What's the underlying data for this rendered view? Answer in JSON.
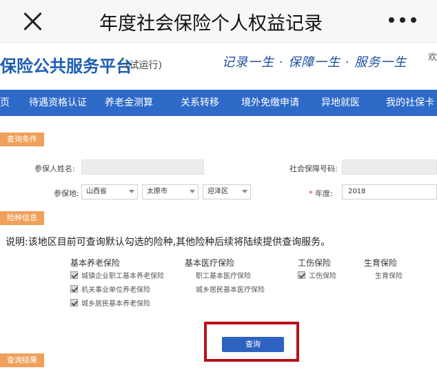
{
  "wechat_bar": {
    "title": "年度社会保险个人权益记录"
  },
  "site": {
    "title": "保险公共服务平台",
    "subtitle": "(试运行)",
    "slogan": "记录一生 · 保障一生 · 服务一生",
    "slogan_tail": "欢"
  },
  "nav": {
    "items": [
      "页",
      "待遇资格认证",
      "养老金测算",
      "关系转移",
      "境外免缴申请",
      "异地就医",
      "我的社保卡"
    ]
  },
  "query_conditions": {
    "tag": "查询条件",
    "name_label": "参保人姓名:",
    "ssn_label": "社会保障号码:",
    "location_label": "参保地:",
    "province": "山西省",
    "city": "太原市",
    "district": "迎泽区",
    "year_label": "年度:",
    "year_value": "2018"
  },
  "insurance_info": {
    "tag": "险种信息",
    "note": "说明:该地区目前可查询默认勾选的险种,其他险种后续将陆续提供查询服务。",
    "groups": [
      {
        "head": "基本养老保险",
        "items": [
          {
            "label": "城镇企业职工基本养老保险",
            "checked": true
          },
          {
            "label": "机关事业单位养老保险",
            "checked": true
          },
          {
            "label": "城乡居民基本养老保险",
            "checked": true
          }
        ]
      },
      {
        "head": "基本医疗保险",
        "items": [
          {
            "label": "职工基本医疗保险",
            "checked": false
          },
          {
            "label": "城乡居民基本医疗保险",
            "checked": false
          }
        ]
      },
      {
        "head": "工伤保险",
        "items": [
          {
            "label": "工伤保险",
            "checked": true
          }
        ]
      },
      {
        "head": "生育保险",
        "items": [
          {
            "label": "生育保险",
            "checked": false
          }
        ]
      }
    ]
  },
  "actions": {
    "query_label": "查询"
  },
  "query_results": {
    "tag": "查询结果"
  }
}
